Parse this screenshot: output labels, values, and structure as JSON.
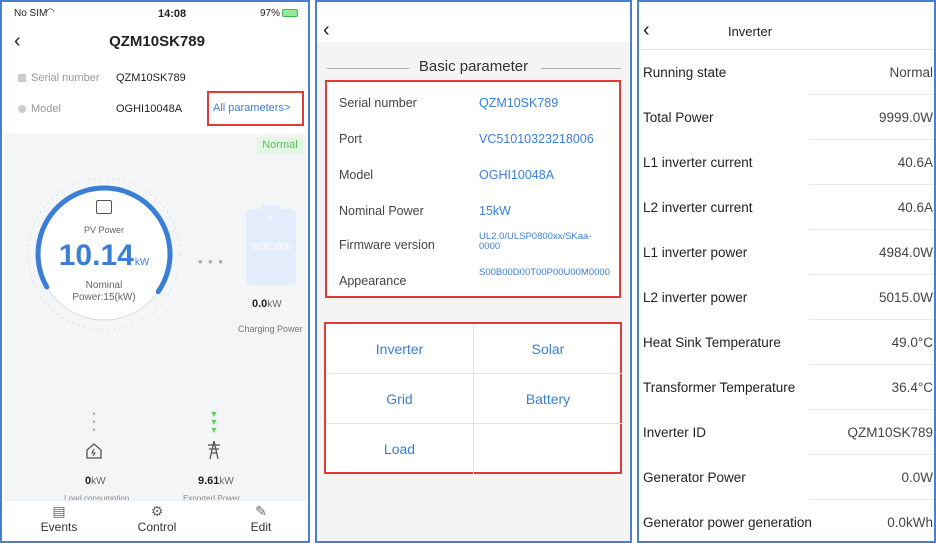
{
  "panel1": {
    "status": {
      "carrier": "No SIM",
      "time": "14:08",
      "battery": "97%"
    },
    "title": "QZM10SK789",
    "serial_label": "Serial number",
    "serial_value": "QZM10SK789",
    "model_label": "Model",
    "model_value": "OGHI10048A",
    "all_params": "All parameters>",
    "status_badge": "Normal",
    "pv_label": "PV Power",
    "pv_value": "10.14",
    "pv_unit": "kW",
    "nominal_label": "Nominal",
    "nominal_value": "Power:15(kW)",
    "battery_soc": "SOC:0%",
    "charging_value": "0.0",
    "charging_unit": "kW",
    "charging_label": "Charging Power",
    "load_value": "0",
    "load_unit": "kW",
    "load_label": "Load consumption",
    "export_value": "9.61",
    "export_unit": "kW",
    "export_label": "Exported Power",
    "nav": {
      "events": "Events",
      "control": "Control",
      "edit": "Edit"
    },
    "ring_fraction": 0.68,
    "accent": "#3a7fd5"
  },
  "panel2": {
    "header": "Basic parameter",
    "rows": [
      {
        "k": "Serial number",
        "v": "QZM10SK789"
      },
      {
        "k": "Port",
        "v": "VC51010323218006"
      },
      {
        "k": "Model",
        "v": "OGHI10048A"
      },
      {
        "k": "Nominal Power",
        "v": "15kW"
      },
      {
        "k": "Firmware version",
        "v": "UL2.0/ULSP0800xx/SKaa-0000"
      },
      {
        "k": "Appearance",
        "v": "S00B00D00T00P00U00M0000"
      }
    ],
    "categories": [
      "Inverter",
      "Solar",
      "Grid",
      "Battery",
      "Load"
    ]
  },
  "panel3": {
    "title": "Inverter",
    "rows": [
      {
        "k": "Running state",
        "v": "Normal"
      },
      {
        "k": "Total Power",
        "v": "9999.0W"
      },
      {
        "k": "L1 inverter current",
        "v": "40.6A"
      },
      {
        "k": "L2 inverter current",
        "v": "40.6A"
      },
      {
        "k": "L1 inverter power",
        "v": "4984.0W"
      },
      {
        "k": "L2 inverter power",
        "v": "5015.0W"
      },
      {
        "k": "Heat Sink Temperature",
        "v": "49.0°C"
      },
      {
        "k": "Transformer Temperature",
        "v": "36.4°C"
      },
      {
        "k": "Inverter ID",
        "v": "QZM10SK789"
      },
      {
        "k": "Generator Power",
        "v": "0.0W"
      },
      {
        "k": "Generator power generation",
        "v": "0.0kWh"
      }
    ]
  }
}
